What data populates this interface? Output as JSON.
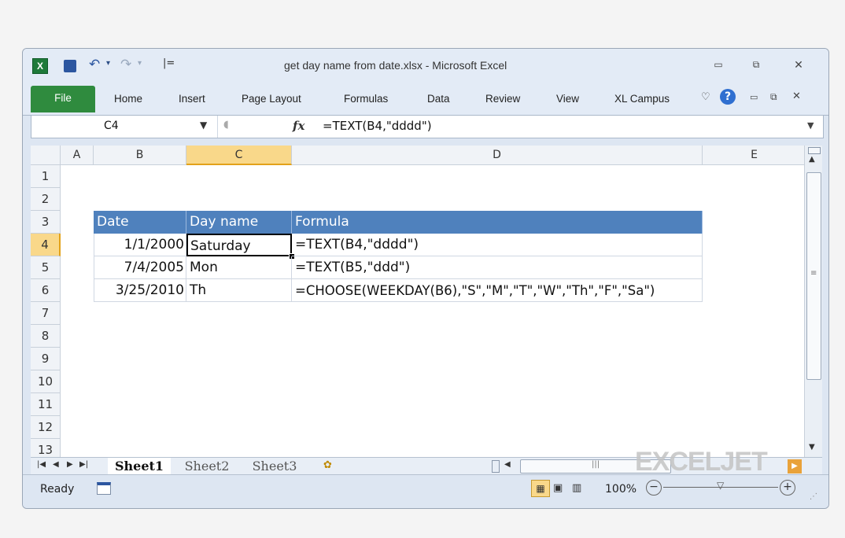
{
  "window": {
    "title": "get day name from date.xlsx - Microsoft Excel",
    "controls": {
      "minimize": "▭",
      "restore": "⧉",
      "close": "✕"
    }
  },
  "ribbon": {
    "file_tab": "File",
    "tabs": [
      "Home",
      "Insert",
      "Page Layout",
      "Formulas",
      "Data",
      "Review",
      "View",
      "XL Campus"
    ]
  },
  "formula_bar": {
    "name_box": "C4",
    "fx_label": "fx",
    "formula": "=TEXT(B4,\"dddd\")"
  },
  "grid": {
    "columns": [
      "A",
      "B",
      "C",
      "D",
      "E"
    ],
    "selected_column": "C",
    "rows": [
      "1",
      "2",
      "3",
      "4",
      "5",
      "6",
      "7",
      "8",
      "9",
      "10",
      "11",
      "12",
      "13"
    ],
    "selected_row": "4",
    "table": {
      "headers": [
        "Date",
        "Day name",
        "Formula"
      ],
      "rows": [
        [
          "1/1/2000",
          "Saturday",
          "=TEXT(B4,\"dddd\")"
        ],
        [
          "7/4/2005",
          "Mon",
          "=TEXT(B5,\"ddd\")"
        ],
        [
          "3/25/2010",
          "Th",
          "=CHOOSE(WEEKDAY(B6),\"S\",\"M\",\"T\",\"W\",\"Th\",\"F\",\"Sa\")"
        ]
      ]
    }
  },
  "sheets": {
    "tabs": [
      "Sheet1",
      "Sheet2",
      "Sheet3"
    ],
    "active": "Sheet1"
  },
  "status_bar": {
    "ready": "Ready",
    "zoom": "100%"
  },
  "watermark": "EXCELJET",
  "colors": {
    "header_fill": "#4f81bd",
    "file_tab": "#2f8b3e",
    "selection": "#f9d88a"
  }
}
